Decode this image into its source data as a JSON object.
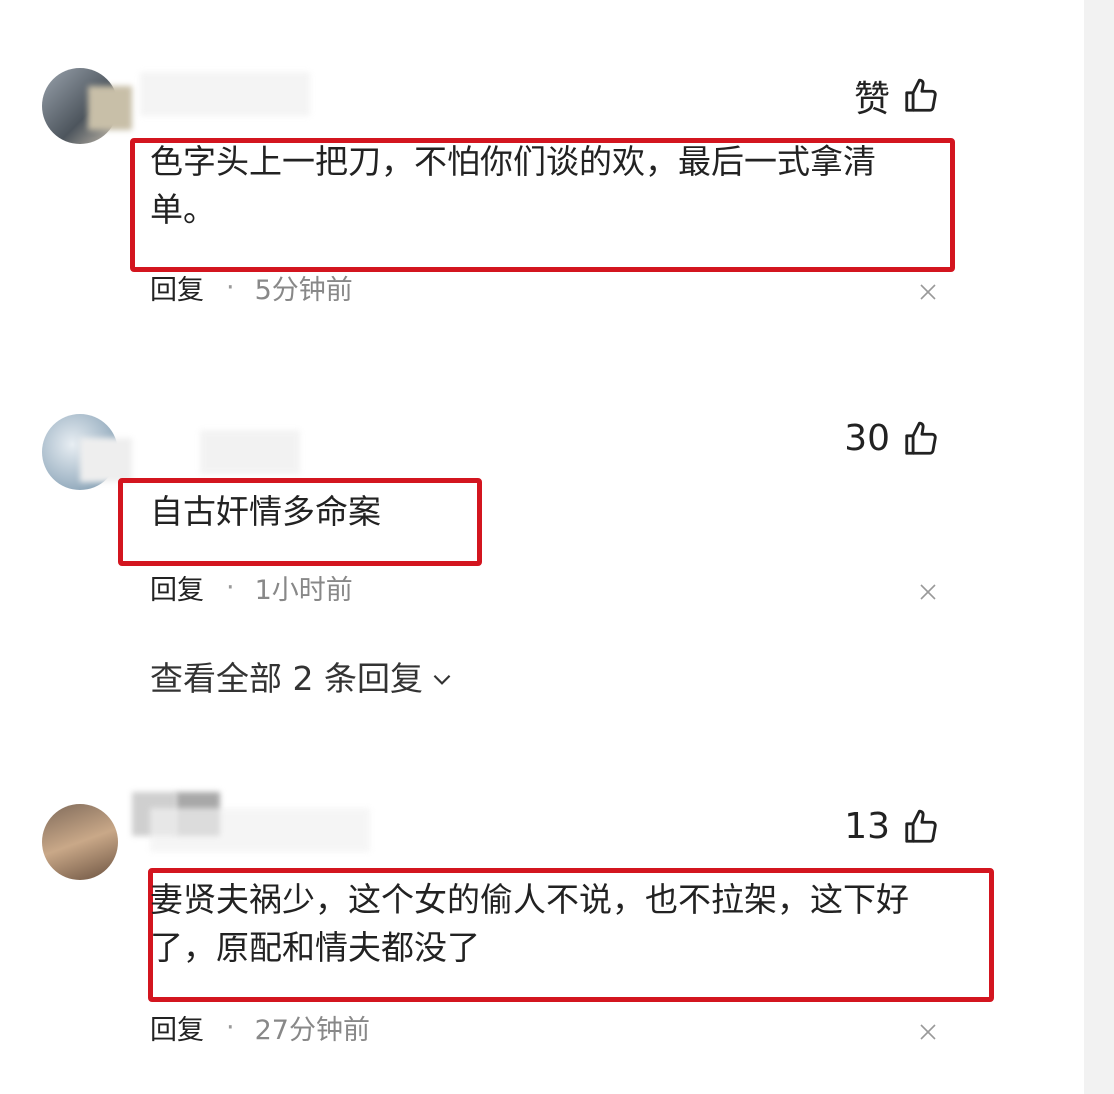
{
  "comments": [
    {
      "like_label": "赞",
      "text_lines": [
        "色字头上一把刀，不怕你们谈的欢，最后一式拿清",
        "单。"
      ],
      "reply_label": "回复",
      "separator": "·",
      "time": "5分钟前"
    },
    {
      "like_label": "30",
      "text_lines": [
        "自古奸情多命案"
      ],
      "reply_label": "回复",
      "separator": "·",
      "time": "1小时前",
      "view_replies": "查看全部 2 条回复"
    },
    {
      "like_label": "13",
      "text_lines": [
        "妻贤夫祸少，这个女的偷人不说，也不拉架，这下好",
        "了，原配和情夫都没了"
      ],
      "reply_label": "回复",
      "separator": "·",
      "time": "27分钟前"
    }
  ],
  "icons": {
    "like": "thumbs-up-outline-icon",
    "close": "close-x-icon",
    "expand": "chevron-down-icon"
  },
  "colors": {
    "highlight_box": "#d3151f",
    "meta_time": "#888888"
  }
}
